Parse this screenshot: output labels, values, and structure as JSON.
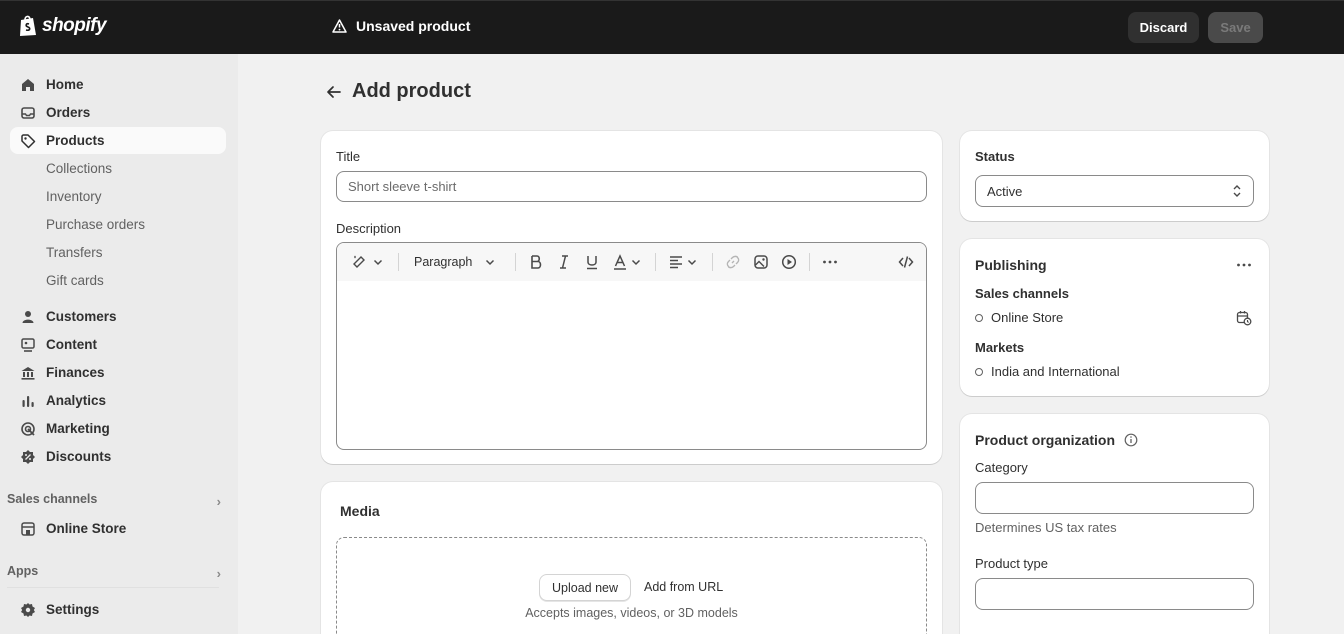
{
  "topbar": {
    "brand": "shopify",
    "status": "Unsaved product",
    "discard_label": "Discard",
    "save_label": "Save"
  },
  "sidebar": {
    "items": [
      {
        "label": "Home",
        "icon": "home-icon"
      },
      {
        "label": "Orders",
        "icon": "inbox-icon"
      },
      {
        "label": "Products",
        "icon": "tag-icon"
      }
    ],
    "sub_items": [
      {
        "label": "Collections"
      },
      {
        "label": "Inventory"
      },
      {
        "label": "Purchase orders"
      },
      {
        "label": "Transfers"
      },
      {
        "label": "Gift cards"
      }
    ],
    "items2": [
      {
        "label": "Customers",
        "icon": "person-icon"
      },
      {
        "label": "Content",
        "icon": "content-icon"
      },
      {
        "label": "Finances",
        "icon": "bank-icon"
      },
      {
        "label": "Analytics",
        "icon": "bar-chart-icon"
      },
      {
        "label": "Marketing",
        "icon": "target-icon"
      },
      {
        "label": "Discounts",
        "icon": "discount-icon"
      }
    ],
    "sales_channels_label": "Sales channels",
    "online_store_label": "Online Store",
    "apps_label": "Apps",
    "settings_label": "Settings"
  },
  "main": {
    "page_title": "Add product",
    "title_label": "Title",
    "title_placeholder": "Short sleeve t-shirt",
    "description_label": "Description",
    "editor": {
      "paragraph_label": "Paragraph",
      "tools": [
        "magic-icon",
        "bold-icon",
        "italic-icon",
        "underline-icon",
        "text-color-icon",
        "align-icon",
        "link-icon",
        "image-icon",
        "video-icon",
        "more-icon",
        "code-icon"
      ]
    },
    "media": {
      "title": "Media",
      "upload_label": "Upload new",
      "url_label": "Add from URL",
      "accepts_text": "Accepts images, videos, or 3D models"
    }
  },
  "right": {
    "status": {
      "title": "Status",
      "value": "Active"
    },
    "publishing": {
      "title": "Publishing",
      "sales_channels_label": "Sales channels",
      "channel": "Online Store",
      "markets_label": "Markets",
      "market": "India and International"
    },
    "organization": {
      "title": "Product organization",
      "category_label": "Category",
      "category_help": "Determines US tax rates",
      "type_label": "Product type"
    }
  }
}
